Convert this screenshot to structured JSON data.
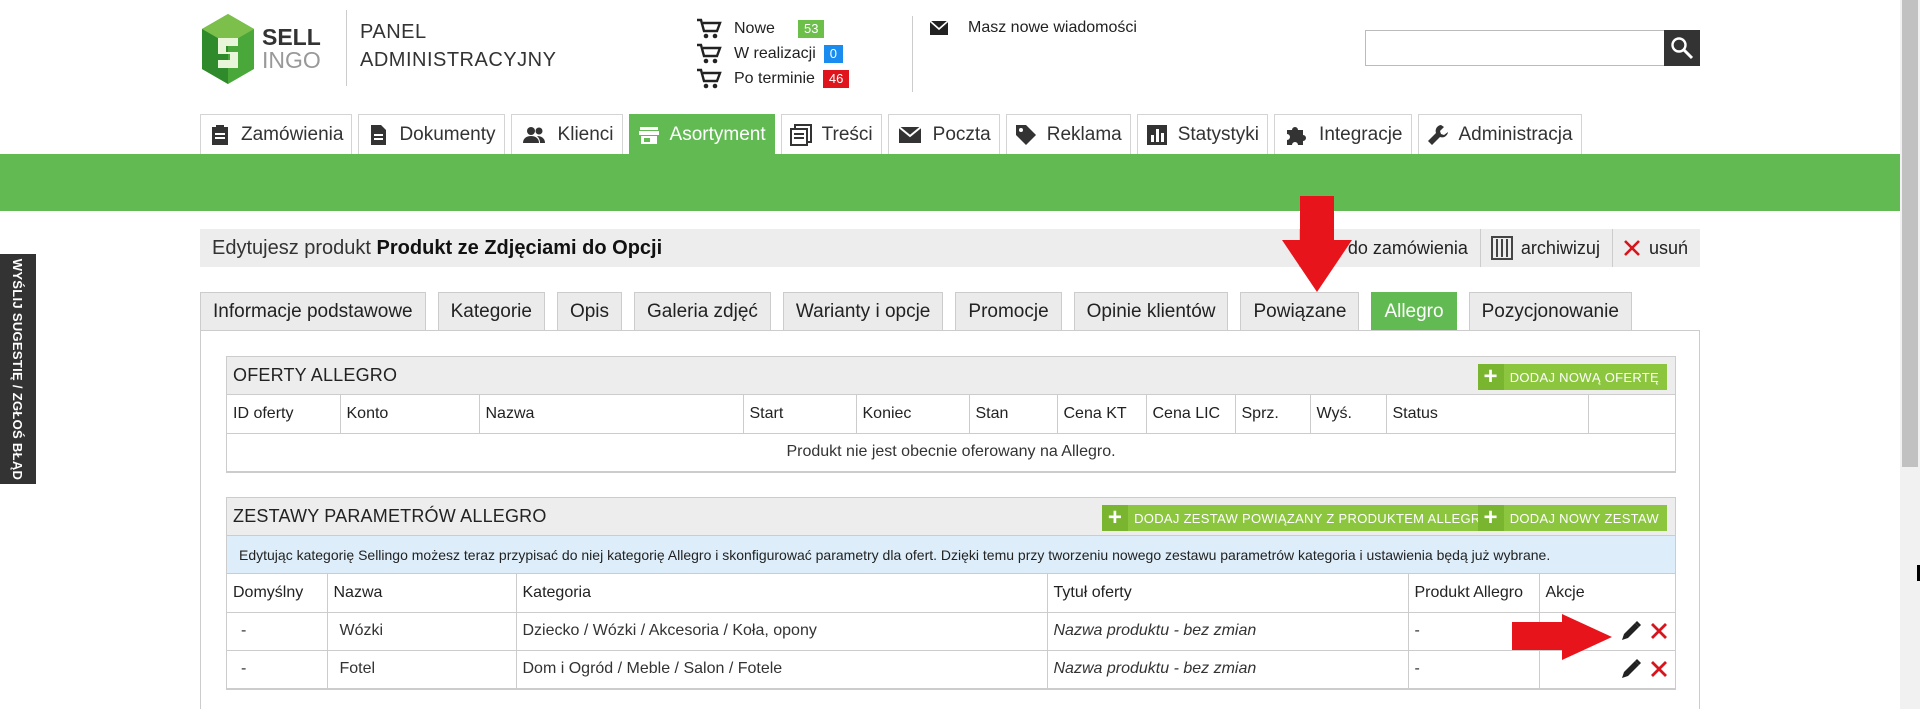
{
  "header": {
    "logo": {
      "sell": "SELL",
      "ingo": "INGO"
    },
    "panel_title_line1": "PANEL",
    "panel_title_line2": "ADMINISTRACYJNY",
    "orders": [
      {
        "label": "Nowe",
        "count": "53",
        "color": "#6cc04a"
      },
      {
        "label": "W realizacji",
        "count": "0",
        "color": "#1a8cf0"
      },
      {
        "label": "Po terminie",
        "count": "46",
        "color": "#e0141c"
      }
    ],
    "messages": "Masz nowe wiadomości",
    "search": {
      "value": "",
      "icon": "search-icon"
    }
  },
  "nav": [
    {
      "label": "Zamówienia",
      "icon": "clipboard-icon"
    },
    {
      "label": "Dokumenty",
      "icon": "document-icon"
    },
    {
      "label": "Klienci",
      "icon": "people-icon"
    },
    {
      "label": "Asortyment",
      "icon": "store-icon",
      "active": true
    },
    {
      "label": "Treści",
      "icon": "list-icon"
    },
    {
      "label": "Poczta",
      "icon": "mail-icon"
    },
    {
      "label": "Reklama",
      "icon": "tag-icon"
    },
    {
      "label": "Statystyki",
      "icon": "chart-icon"
    },
    {
      "label": "Integracje",
      "icon": "puzzle-icon"
    },
    {
      "label": "Administracja",
      "icon": "wrench-icon"
    }
  ],
  "side_tab": "WYŚLIJ SUGESTIĘ / ZGŁOŚ BŁĄD",
  "product": {
    "prefix": "Edytujesz produkt",
    "name": "Produkt ze Zdjęciami do Opcji",
    "actions": [
      {
        "label": "do zamówienia",
        "icon": "cart-icon"
      },
      {
        "label": "archiwizuj",
        "icon": "archive-icon"
      },
      {
        "label": "usuń",
        "icon": "close-icon"
      }
    ]
  },
  "tabs": [
    "Informacje podstawowe",
    "Kategorie",
    "Opis",
    "Galeria zdjęć",
    "Warianty i opcje",
    "Promocje",
    "Opinie klientów",
    "Powiązane",
    "Allegro",
    "Pozycjonowanie"
  ],
  "active_tab": "Allegro",
  "offers": {
    "title": "OFERTY ALLEGRO",
    "add_button": "DODAJ NOWĄ OFERTĘ",
    "columns": [
      "ID oferty",
      "Konto",
      "Nazwa",
      "Start",
      "Koniec",
      "Stan",
      "Cena KT",
      "Cena LIC",
      "Sprz.",
      "Wyś.",
      "Status",
      ""
    ],
    "empty_text": "Produkt nie jest obecnie oferowany na Allegro."
  },
  "params": {
    "title": "ZESTAWY PARAMETRÓW ALLEGRO",
    "add_linked_button": "DODAJ ZESTAW POWIĄZANY Z PRODUKTEM ALLEGRO",
    "add_new_button": "DODAJ NOWY ZESTAW",
    "info": "Edytując kategorię Sellingo możesz teraz przypisać do niej kategorię Allegro i skonfigurować parametry dla ofert. Dzięki temu przy tworzeniu nowego zestawu parametrów kategoria i ustawienia będą już wybrane.",
    "columns": [
      "Domyślny",
      "Nazwa",
      "Kategoria",
      "Tytuł oferty",
      "Produkt Allegro",
      "Akcje"
    ],
    "rows": [
      {
        "default": "-",
        "name": "Wózki",
        "category": "Dziecko / Wózki / Akcesoria / Koła, opony",
        "title": "Nazwa produktu - bez zmian",
        "product": "-"
      },
      {
        "default": "-",
        "name": "Fotel",
        "category": "Dom i Ogród / Meble / Salon / Fotele",
        "title": "Nazwa produktu - bez zmian",
        "product": "-"
      }
    ]
  },
  "colors": {
    "accent_green": "#62bb52",
    "button_green": "#8cc63f",
    "arrow_red": "#e8141c",
    "info_blue": "#ddeefa"
  }
}
